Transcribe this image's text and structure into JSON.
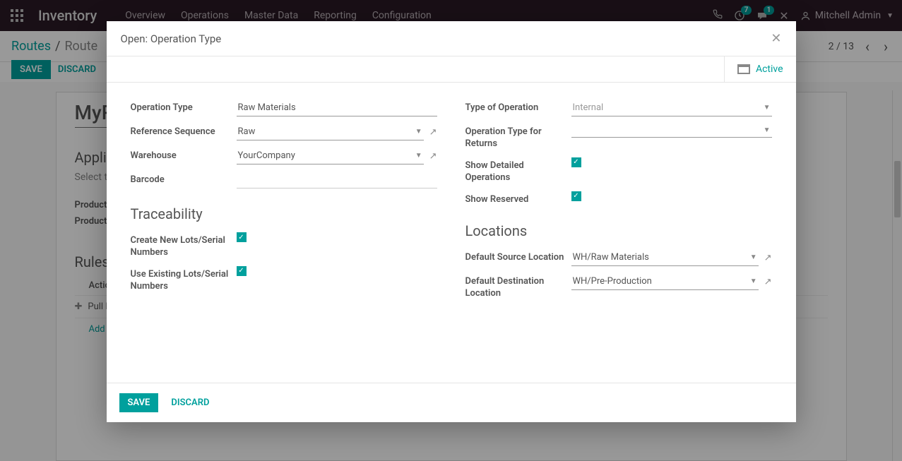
{
  "topnav": {
    "brand": "Inventory",
    "menu": [
      "Overview",
      "Operations",
      "Master Data",
      "Reporting",
      "Configuration"
    ],
    "badge_clock": "7",
    "badge_chat": "1",
    "user": "Mitchell Admin"
  },
  "breadcrumb": {
    "root": "Routes",
    "current": "Route",
    "pager": "2 / 13"
  },
  "buttons": {
    "save": "SAVE",
    "discard": "DISCARD"
  },
  "sheet": {
    "title": "MyR",
    "appl_title": "Applic",
    "appl_sub": "Select the",
    "row_pc": "Product C",
    "row_p": "Products",
    "rules": "Rules",
    "rules_header": "Actio",
    "rule_pull": "Pull F",
    "add_line": "Add a"
  },
  "modal": {
    "title": "Open: Operation Type",
    "active": "Active",
    "labels": {
      "op_type": "Operation Type",
      "ref_seq": "Reference Sequence",
      "warehouse": "Warehouse",
      "barcode": "Barcode",
      "type_op": "Type of Operation",
      "op_returns": "Operation Type for Returns",
      "show_detailed": "Show Detailed Operations",
      "show_reserved": "Show Reserved",
      "traceability": "Traceability",
      "create_lots": "Create New Lots/Serial Numbers",
      "use_lots": "Use Existing Lots/Serial Numbers",
      "locations": "Locations",
      "def_source": "Default Source Location",
      "def_dest": "Default Destination Location"
    },
    "values": {
      "op_type": "Raw Materials",
      "ref_seq": "Raw",
      "warehouse": "YourCompany",
      "barcode": "",
      "type_op": "Internal",
      "op_returns": "",
      "def_source": "WH/Raw Materials",
      "def_dest": "WH/Pre-Production"
    },
    "footer": {
      "save": "SAVE",
      "discard": "DISCARD"
    }
  }
}
